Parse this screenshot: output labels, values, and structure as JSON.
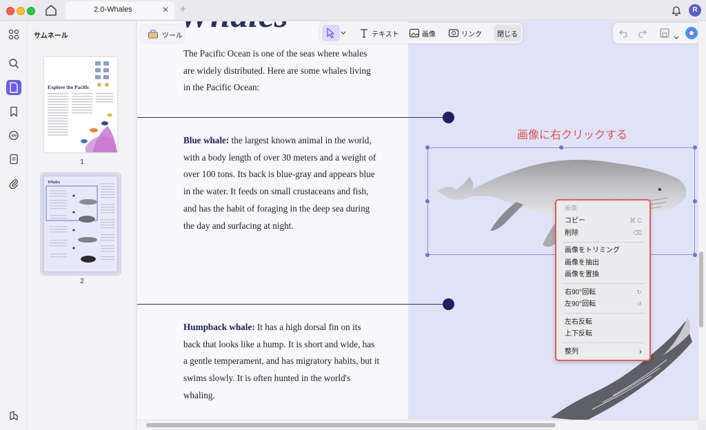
{
  "window": {
    "tab_title": "2.0-Whales",
    "tab_close": "✕",
    "tab_add": "+",
    "avatar_initial": "R"
  },
  "rail": {
    "icons": [
      "grid-icon",
      "search-icon",
      "page-icon",
      "bookmark-icon",
      "comment-icon",
      "form-icon",
      "attachment-icon",
      "layers-icon"
    ]
  },
  "thumbnails": {
    "title": "サムネール",
    "pages": [
      {
        "number": "1",
        "caption": "Explore the Pacific"
      },
      {
        "number": "2",
        "caption": "Whales"
      }
    ]
  },
  "toolbar": {
    "tools_label": "ツール",
    "text_label": "テキスト",
    "image_label": "画像",
    "link_label": "リンク",
    "close_label": "閉じる"
  },
  "document": {
    "heading_fragment": "Whales",
    "intro": "The Pacific Ocean is one of the seas where whales are widely distributed. Here are some whales living in the Pacific Ocean:",
    "blue_whale_title": "Blue whale:",
    "blue_whale_text": " the largest known animal in the world, with a body length of over 30 meters and a weight of over 100 tons. Its back is blue-gray and appears blue in the water. It feeds on small crustaceans and fish, and has the habit of foraging in the deep sea during the day and surfacing at night.",
    "humpback_title": "Humpback whale:",
    "humpback_text": " It has a high dorsal fin on its back that looks like a hump. It is short and wide, has a gentle temperament, and has migratory habits, but it swims slowly. It is often hunted in the world's whaling."
  },
  "annotation": "画像に右クリックする",
  "context_menu": {
    "header": "画像",
    "copy": "コピー",
    "copy_shortcut": "⌘ C",
    "delete": "削除",
    "delete_shortcut": "⌫",
    "trim": "画像をトリミング",
    "extract": "画像を抽出",
    "replace": "画像を置換",
    "rotate_right": "右90°回転",
    "rotate_right_icon": "↻",
    "rotate_left": "左90°回転",
    "rotate_left_icon": "↺",
    "flip_horizontal": "左右反転",
    "flip_vertical": "上下反転",
    "align": "整列",
    "align_arrow": "›"
  }
}
